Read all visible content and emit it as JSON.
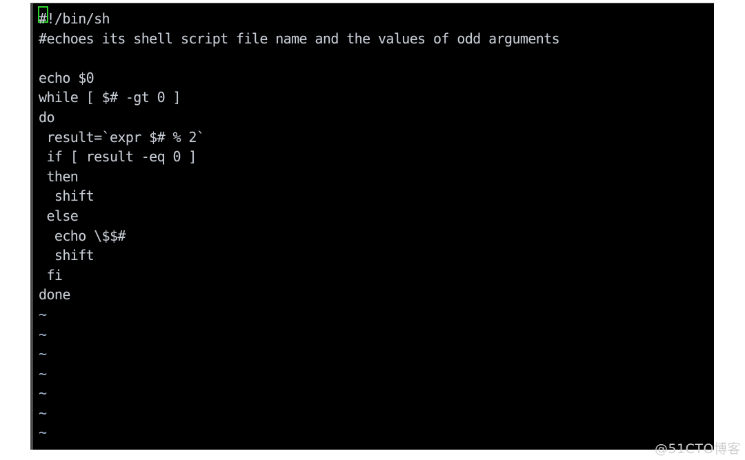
{
  "app": {
    "type": "terminal",
    "editor": "vim",
    "background_color": "#000000",
    "foreground_color": "#c8cdd4",
    "cursor_color": "#2fd62f",
    "page_background": "#ffffff"
  },
  "editor": {
    "cursor": {
      "line": 1,
      "column": 1,
      "character": "#"
    },
    "lines": [
      {
        "n": 1,
        "text": "#!/bin/sh",
        "kind": "code"
      },
      {
        "n": 2,
        "text": "#echoes its shell script file name and the values of odd arguments",
        "kind": "code"
      },
      {
        "n": 3,
        "text": "",
        "kind": "code"
      },
      {
        "n": 4,
        "text": "echo $0",
        "kind": "code"
      },
      {
        "n": 5,
        "text": "while [ $# -gt 0 ]",
        "kind": "code"
      },
      {
        "n": 6,
        "text": "do",
        "kind": "code"
      },
      {
        "n": 7,
        "text": " result=`expr $# % 2`",
        "kind": "code"
      },
      {
        "n": 8,
        "text": " if [ result -eq 0 ]",
        "kind": "code"
      },
      {
        "n": 9,
        "text": " then",
        "kind": "code"
      },
      {
        "n": 10,
        "text": "  shift",
        "kind": "code"
      },
      {
        "n": 11,
        "text": " else",
        "kind": "code"
      },
      {
        "n": 12,
        "text": "  echo \\$$#",
        "kind": "code"
      },
      {
        "n": 13,
        "text": "  shift",
        "kind": "code"
      },
      {
        "n": 14,
        "text": " fi",
        "kind": "code"
      },
      {
        "n": 15,
        "text": "done",
        "kind": "code"
      },
      {
        "n": 16,
        "text": "~",
        "kind": "tilde"
      },
      {
        "n": 17,
        "text": "~",
        "kind": "tilde"
      },
      {
        "n": 18,
        "text": "~",
        "kind": "tilde"
      },
      {
        "n": 19,
        "text": "~",
        "kind": "tilde"
      },
      {
        "n": 20,
        "text": "~",
        "kind": "tilde"
      },
      {
        "n": 21,
        "text": "~",
        "kind": "tilde"
      },
      {
        "n": 22,
        "text": "~",
        "kind": "tilde"
      },
      {
        "n": 23,
        "text": "~",
        "kind": "tilde"
      }
    ]
  },
  "watermark": {
    "text": "@51CTO博客",
    "color": "#cfcfcf"
  }
}
